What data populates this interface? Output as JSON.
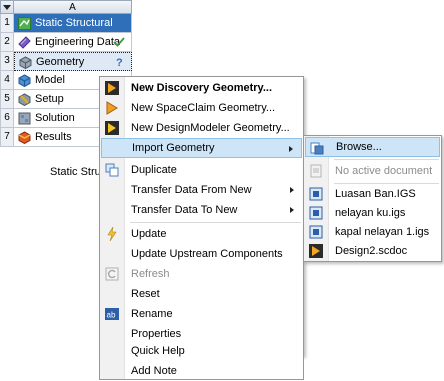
{
  "system": {
    "column_header": "A",
    "caption": "Static Structural",
    "rows": [
      {
        "num": "1",
        "label": "Static Structural",
        "icon": "static-structural-icon"
      },
      {
        "num": "2",
        "label": "Engineering Data",
        "icon": "engineering-data-icon",
        "status": "✓"
      },
      {
        "num": "3",
        "label": "Geometry",
        "icon": "geometry-icon",
        "status": "?"
      },
      {
        "num": "4",
        "label": "Model",
        "icon": "model-icon"
      },
      {
        "num": "5",
        "label": "Setup",
        "icon": "setup-icon"
      },
      {
        "num": "6",
        "label": "Solution",
        "icon": "solution-icon"
      },
      {
        "num": "7",
        "label": "Results",
        "icon": "results-icon"
      }
    ]
  },
  "context_menu": {
    "items": [
      {
        "label": "New Discovery Geometry...",
        "icon": "discovery-icon"
      },
      {
        "label": "New SpaceClaim Geometry...",
        "icon": "spaceclaim-icon"
      },
      {
        "label": "New DesignModeler Geometry...",
        "icon": "designmodeler-icon"
      },
      {
        "label": "Import Geometry"
      },
      {
        "label": "Duplicate",
        "icon": "duplicate-icon"
      },
      {
        "label": "Transfer Data From New"
      },
      {
        "label": "Transfer Data To New"
      },
      {
        "label": "Update",
        "icon": "update-icon"
      },
      {
        "label": "Update Upstream Components"
      },
      {
        "label": "Refresh",
        "icon": "refresh-icon"
      },
      {
        "label": "Reset"
      },
      {
        "label": "Rename",
        "icon": "rename-icon"
      },
      {
        "label": "Properties"
      },
      {
        "label": "Quick Help"
      },
      {
        "label": "Add Note"
      }
    ]
  },
  "submenu": {
    "items": [
      {
        "label": "Browse...",
        "icon": "browse-icon"
      },
      {
        "label": "No active document",
        "icon": "document-icon"
      },
      {
        "label": "Luasan Ban.IGS",
        "icon": "igs-file-icon"
      },
      {
        "label": "nelayan ku.igs",
        "icon": "igs-file-icon"
      },
      {
        "label": "kapal nelayan 1.igs",
        "icon": "igs-file-icon"
      },
      {
        "label": "Design2.scdoc",
        "icon": "scdoc-file-icon"
      }
    ]
  },
  "colors": {
    "title_row": "#2f6fba",
    "highlight": "#cde5f7",
    "check": "#3a9c3a",
    "question": "#2f6fba"
  }
}
